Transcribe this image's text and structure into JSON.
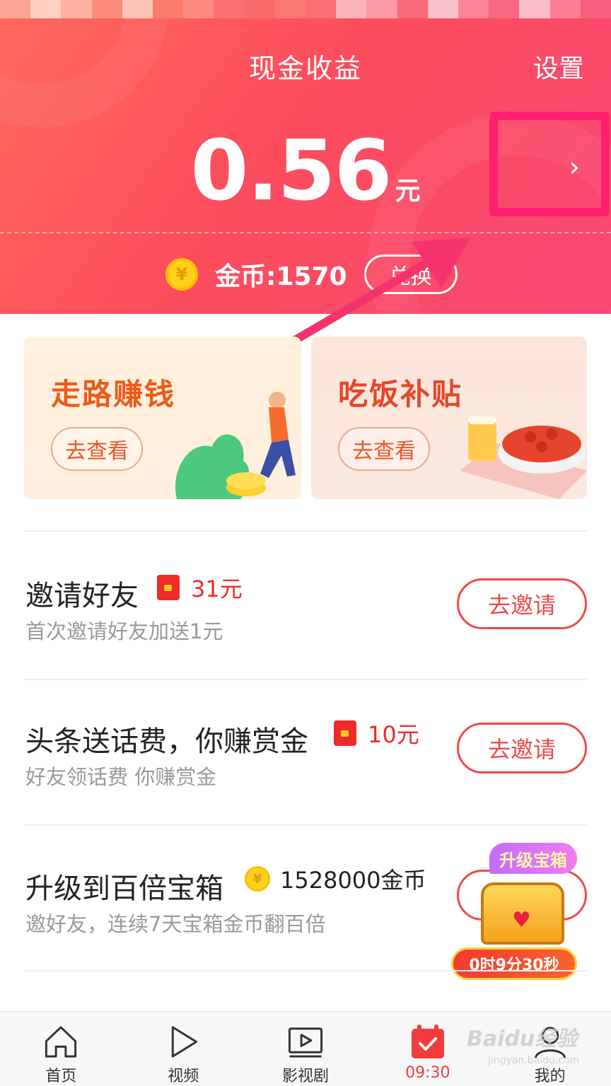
{
  "header": {
    "title": "现金收益",
    "settings_label": "设置",
    "amount": "0.56",
    "unit": "元",
    "detail_chevron": "›",
    "coin_symbol": "¥",
    "coins_label": "金币:1570",
    "exchange_label": "兑换",
    "colors": {
      "gradient_start": "#ff6a5c",
      "gradient_end": "#f94873",
      "highlight_box": "#ff1f6e"
    }
  },
  "cards": [
    {
      "title": "走路赚钱",
      "button": "去查看"
    },
    {
      "title": "吃饭补贴",
      "button": "去查看"
    }
  ],
  "tasks": [
    {
      "title": "邀请好友",
      "reward": "31元",
      "reward_icon": "red-envelope-icon",
      "subtitle": "首次邀请好友加送1元",
      "button": "去邀请"
    },
    {
      "title": "头条送话费，你赚赏金",
      "reward": "10元",
      "reward_icon": "red-envelope-icon",
      "subtitle": "好友领话费 你赚赏金",
      "button": "去邀请"
    },
    {
      "title": "升级到百倍宝箱",
      "reward": "1528000金币",
      "reward_icon": "gold-coin-icon",
      "coin_symbol": "¥",
      "subtitle": "邀好友，连续7天宝箱金币翻百倍",
      "tag": "升级宝箱",
      "timer": "0时9分30秒"
    }
  ],
  "tabbar": [
    {
      "label": "首页",
      "icon": "home-icon"
    },
    {
      "label": "视频",
      "icon": "play-icon"
    },
    {
      "label": "影视剧",
      "icon": "tv-icon"
    },
    {
      "label": "09:30",
      "icon": "calendar-check-icon",
      "active": true
    },
    {
      "label": "我的",
      "icon": "user-icon"
    }
  ],
  "watermark": {
    "brand": "Baidu经验",
    "url": "jingyan.baidu.com"
  },
  "accent_color": "#f23d3d"
}
